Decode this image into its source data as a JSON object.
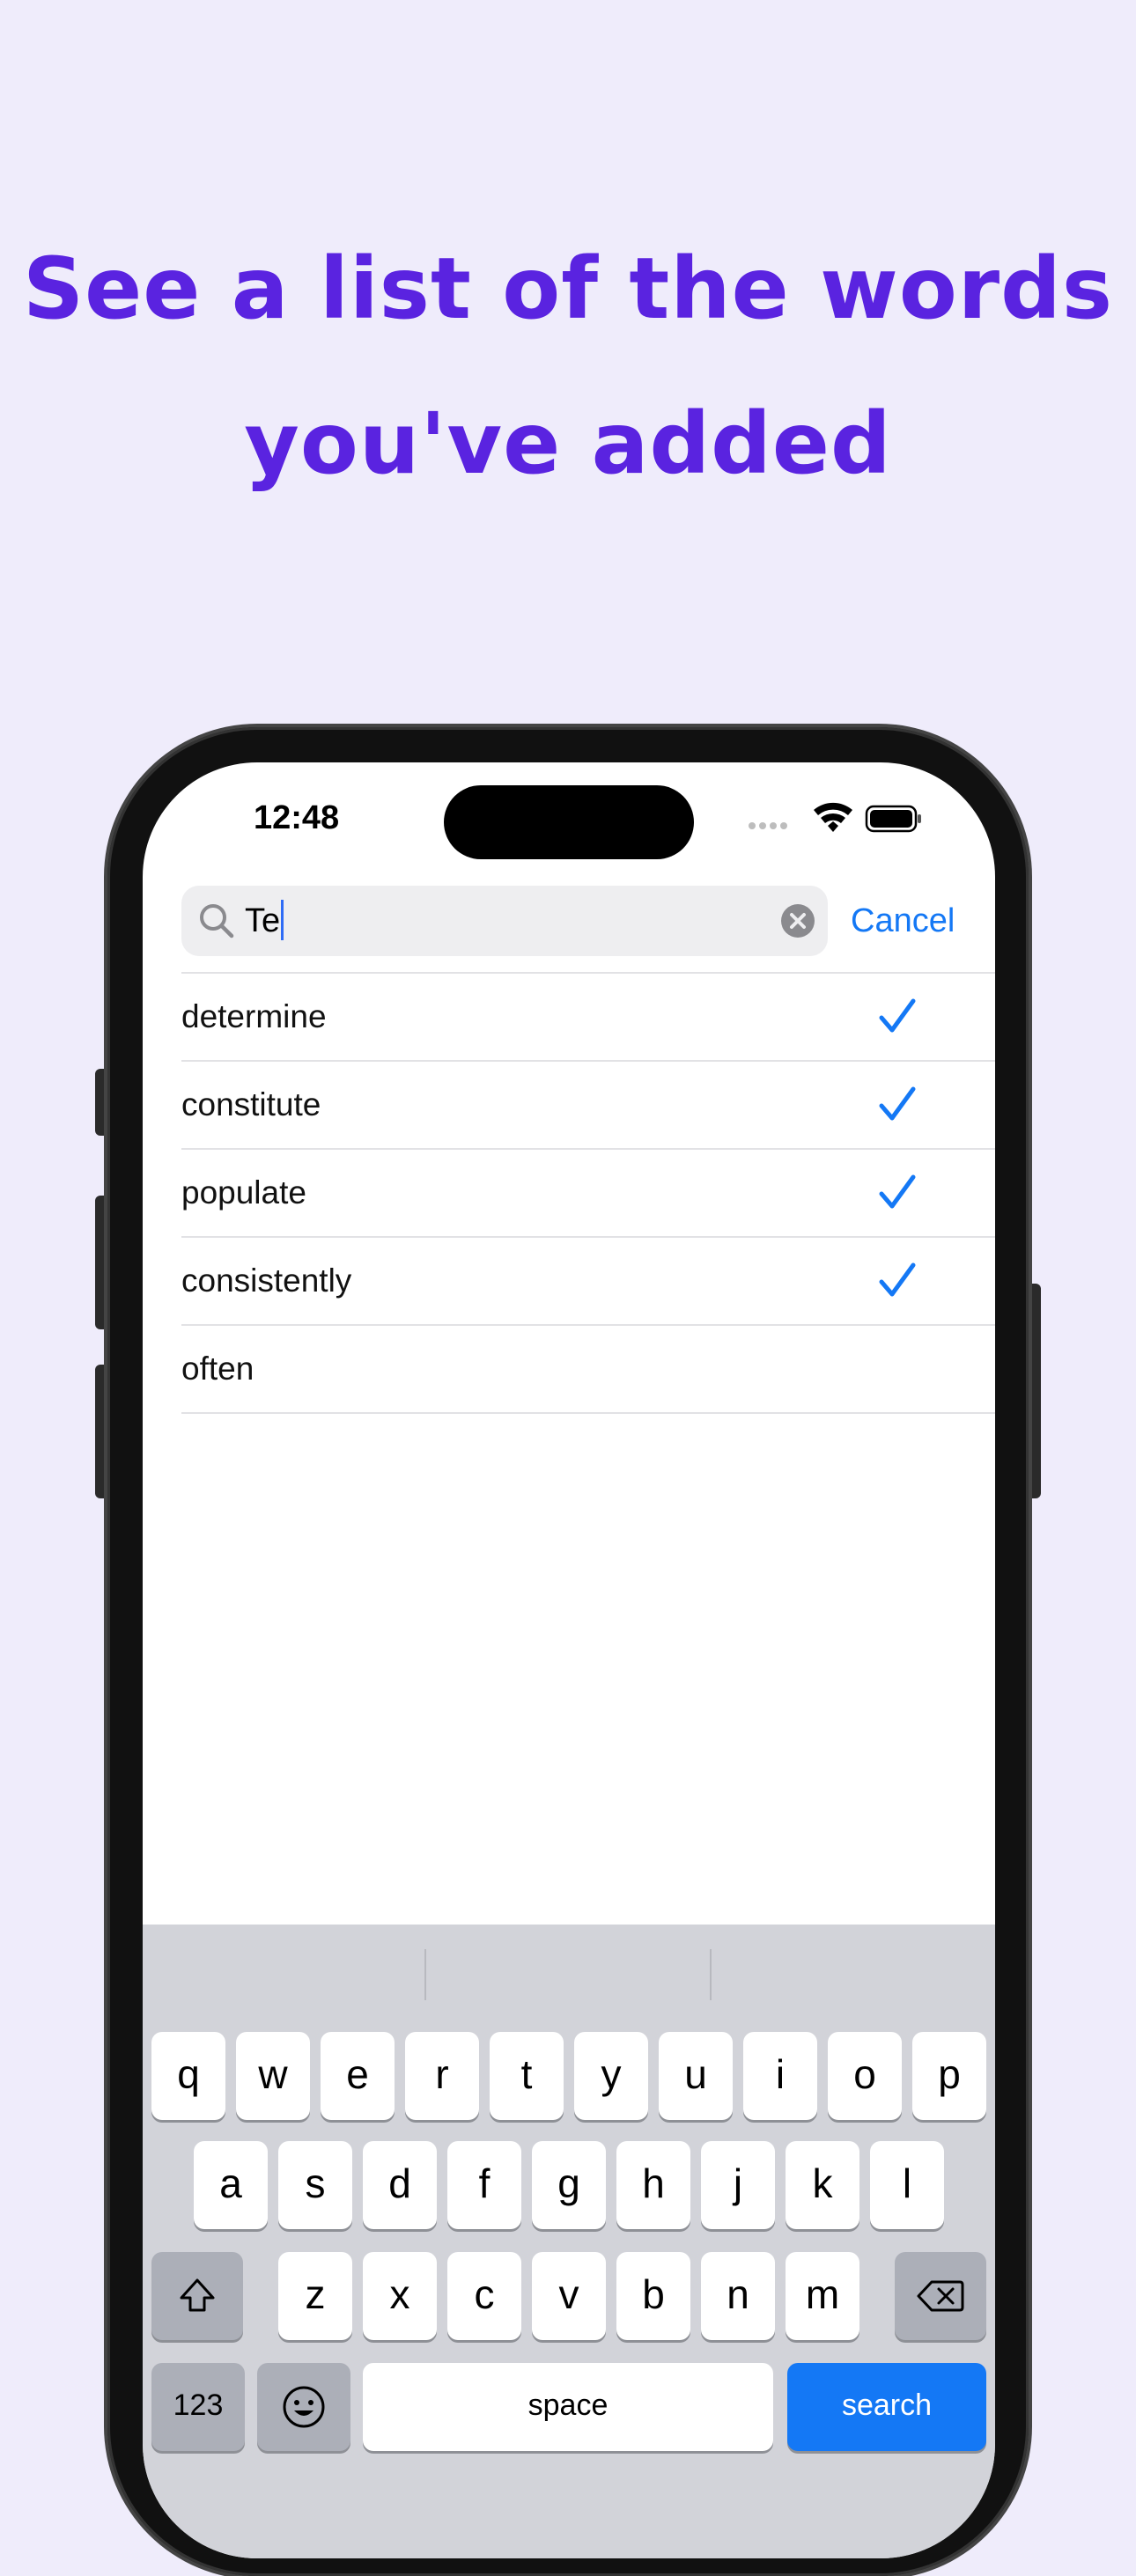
{
  "headline": {
    "line1": "See a list of the words",
    "line2": "you've added"
  },
  "status_bar": {
    "time": "12:48"
  },
  "search": {
    "query": "Te",
    "cancel_label": "Cancel"
  },
  "words": [
    {
      "label": "determine",
      "checked": true
    },
    {
      "label": "constitute",
      "checked": true
    },
    {
      "label": "populate",
      "checked": true
    },
    {
      "label": "consistently",
      "checked": true
    },
    {
      "label": "often",
      "checked": false
    }
  ],
  "keyboard": {
    "row1": [
      "q",
      "w",
      "e",
      "r",
      "t",
      "y",
      "u",
      "i",
      "o",
      "p"
    ],
    "row2": [
      "a",
      "s",
      "d",
      "f",
      "g",
      "h",
      "j",
      "k",
      "l"
    ],
    "row3": [
      "z",
      "x",
      "c",
      "v",
      "b",
      "n",
      "m"
    ],
    "numbers_label": "123",
    "space_label": "space",
    "search_label": "search"
  },
  "colors": {
    "background": "#efecfb",
    "headline": "#5a23e0",
    "accent": "#1478f5"
  }
}
